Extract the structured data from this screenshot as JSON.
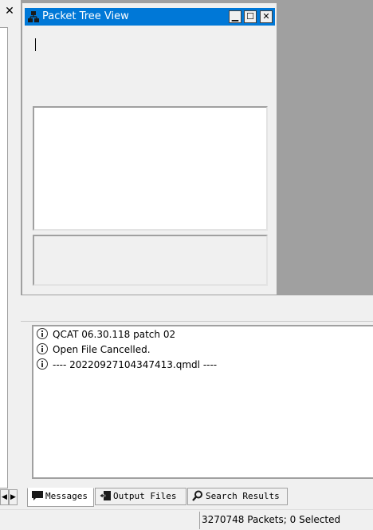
{
  "left_pane": {
    "close_glyph": "✕",
    "scroll_left_glyph": "◀",
    "scroll_right_glyph": "▶"
  },
  "packet_tree_view": {
    "title": "Packet Tree View",
    "icon": "packet-tree-icon",
    "minimize_glyph": "▁",
    "maximize_glyph": "☐",
    "close_glyph": "✕",
    "title_color": "#0078d7"
  },
  "messages": [
    {
      "icon": "info-icon",
      "text": "QCAT 06.30.118 patch 02"
    },
    {
      "icon": "info-icon",
      "text": "Open File Cancelled."
    },
    {
      "icon": "info-icon",
      "text": "---- 20220927104347413.qmdl ----"
    }
  ],
  "tabs": [
    {
      "label": "Messages",
      "icon": "messages-icon",
      "active": true
    },
    {
      "label": "Output Files",
      "icon": "output-files-icon",
      "active": false
    },
    {
      "label": "Search Results",
      "icon": "search-icon",
      "active": false
    }
  ],
  "status": {
    "text": "3270748 Packets; 0 Selected"
  }
}
